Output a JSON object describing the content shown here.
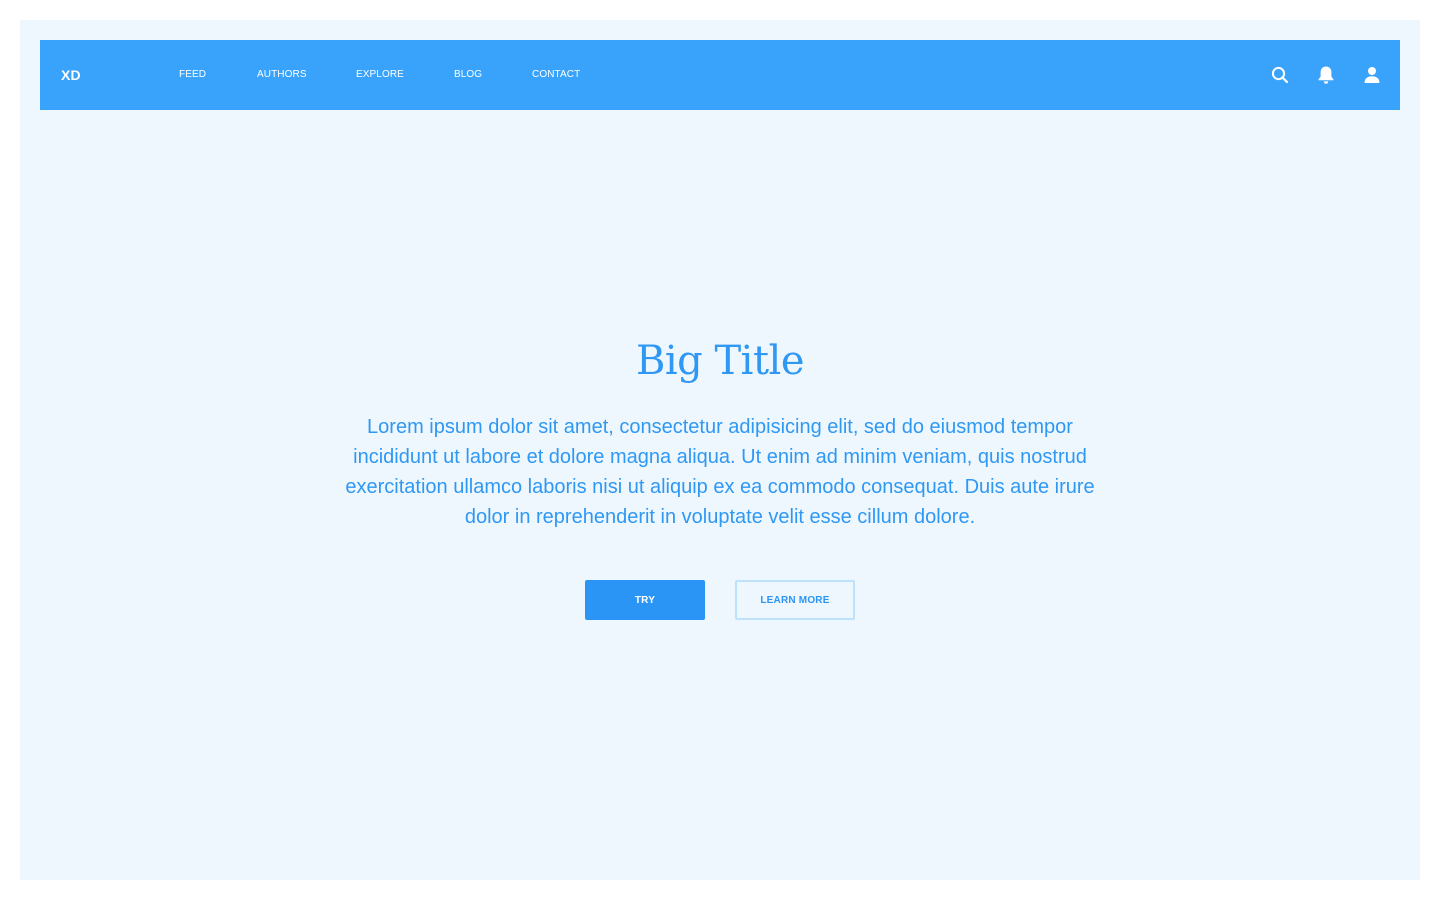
{
  "brand": {
    "logo": "XD"
  },
  "nav": {
    "items": [
      {
        "label": "FEED"
      },
      {
        "label": "AUTHORS"
      },
      {
        "label": "EXPLORE"
      },
      {
        "label": "BLOG"
      },
      {
        "label": "CONTACT"
      }
    ],
    "icons": [
      "search-icon",
      "bell-icon",
      "user-icon"
    ]
  },
  "hero": {
    "title": "Big Title",
    "text": "Lorem ipsum dolor sit amet, consectetur adipisicing elit, sed do eiusmod tempor incididunt ut labore et dolore magna aliqua. Ut enim ad minim veniam, quis nostrud exercitation ullamco laboris nisi ut aliquip ex ea commodo consequat. Duis aute irure dolor in reprehenderit in voluptate velit esse cillum dolore.",
    "primary_button": "TRY",
    "secondary_button": "LEARN MORE"
  },
  "colors": {
    "navbar": "#39a3fb",
    "background": "#eef7fe",
    "accent": "#2a95f5",
    "outline": "#bfe2fc"
  }
}
